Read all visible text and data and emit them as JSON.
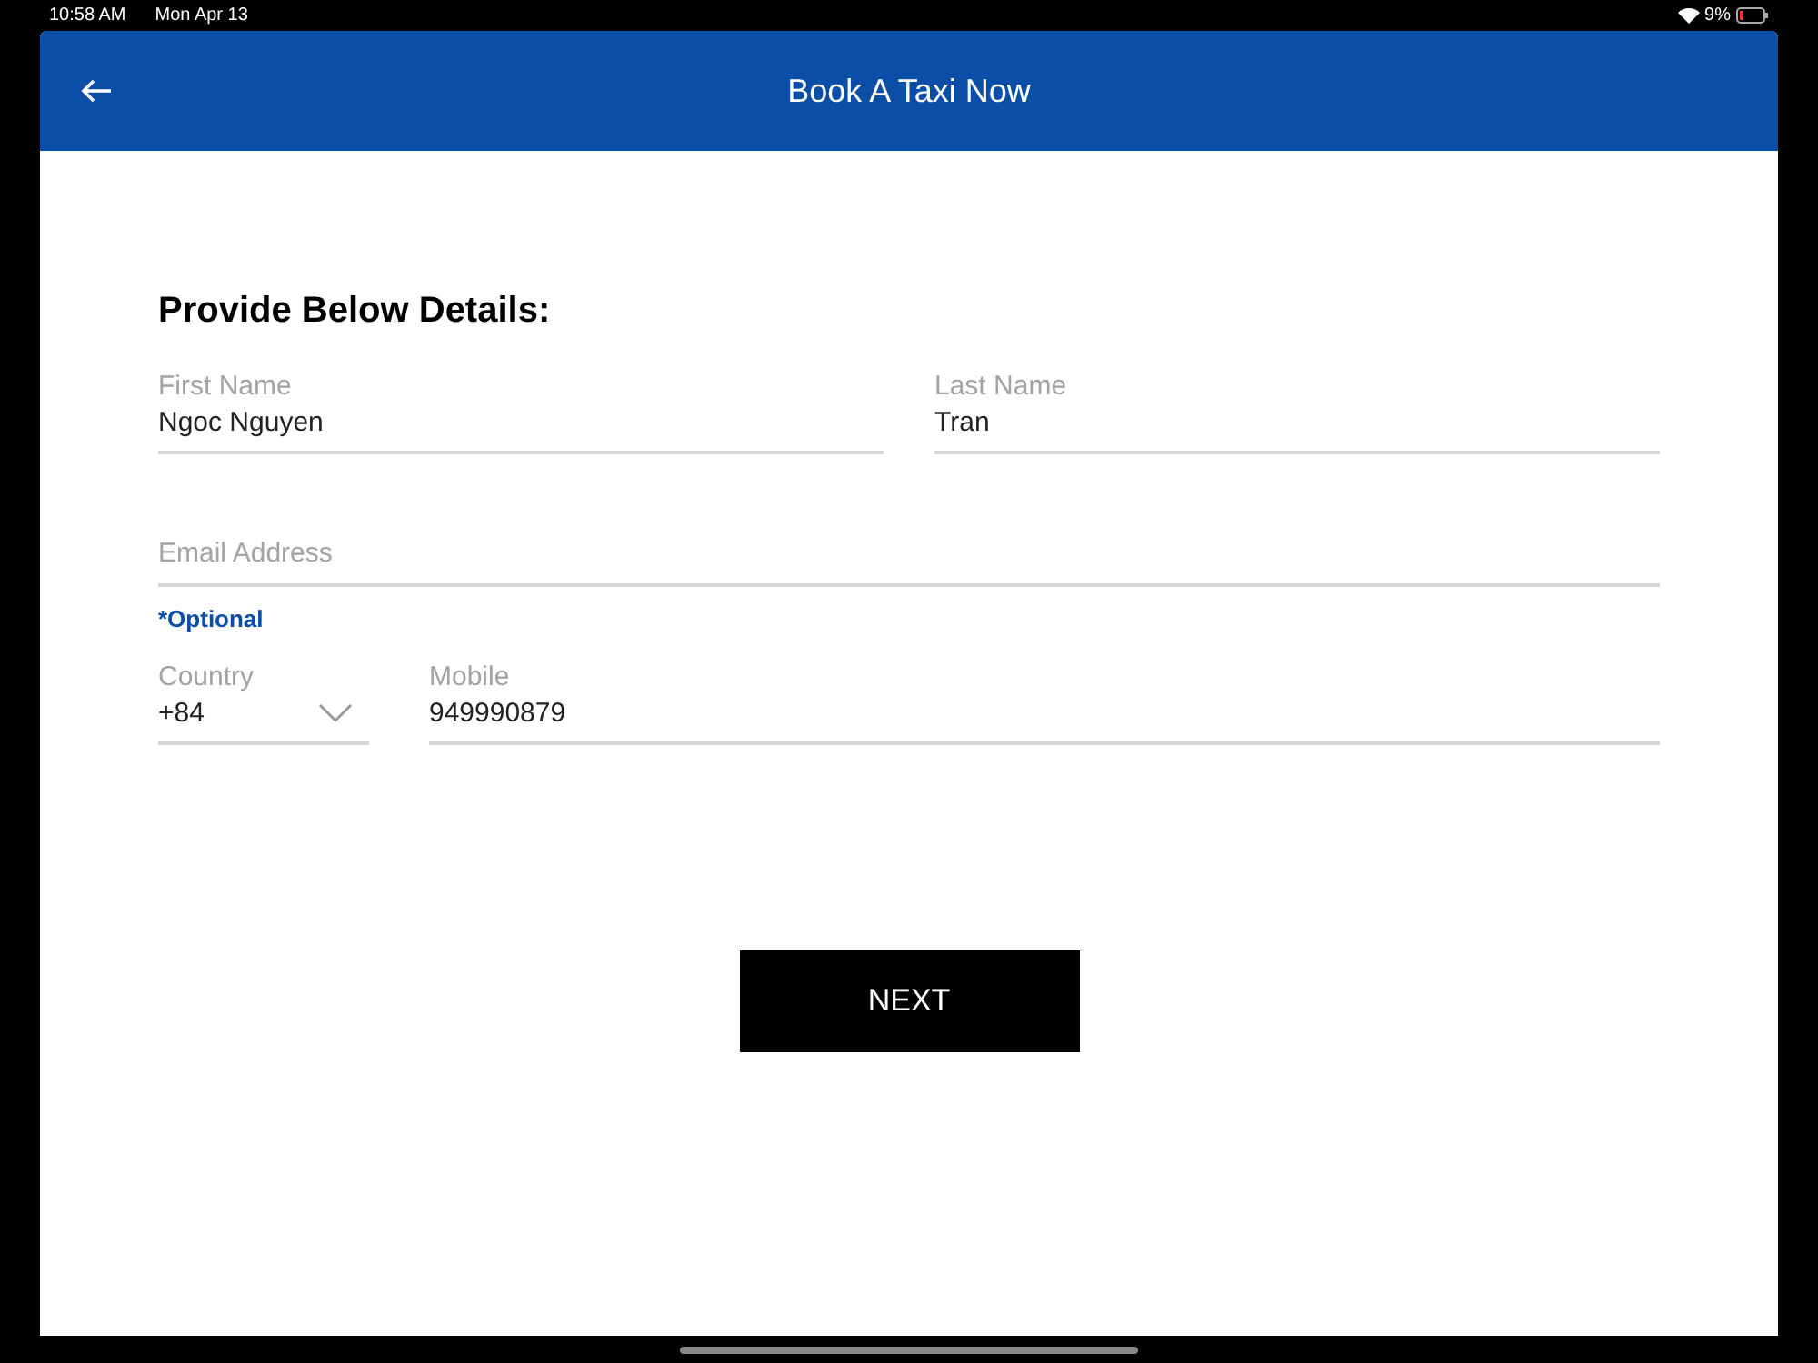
{
  "status_bar": {
    "time": "10:58 AM",
    "date": "Mon Apr 13",
    "battery": "9%"
  },
  "header": {
    "title": "Book A Taxi Now"
  },
  "form": {
    "heading": "Provide Below Details:",
    "first_name": {
      "label": "First Name",
      "value": "Ngoc Nguyen"
    },
    "last_name": {
      "label": "Last Name",
      "value": "Tran"
    },
    "email": {
      "placeholder": "Email Address",
      "note": "*Optional"
    },
    "country": {
      "label": "Country",
      "value": "+84"
    },
    "mobile": {
      "label": "Mobile",
      "value": "949990879"
    }
  },
  "button": "NEXT"
}
